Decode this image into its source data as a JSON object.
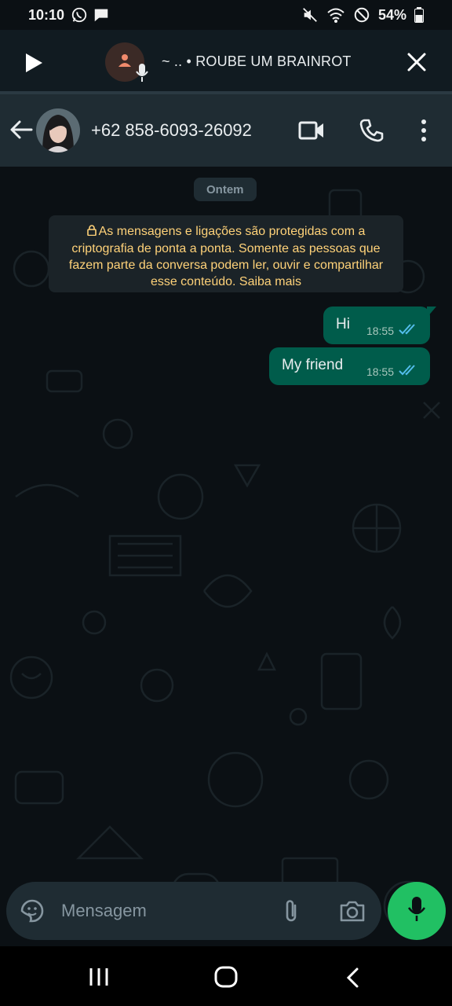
{
  "status_bar": {
    "time": "10:10",
    "battery": "54%"
  },
  "voice_banner": {
    "title": "~ .. • ROUBE UM BRAINROT"
  },
  "header": {
    "contact_name": "+62 858-6093-26092"
  },
  "chat": {
    "date_chip": "Ontem",
    "encryption_notice": "As mensagens e ligações são protegidas com a criptografia de ponta a ponta. Somente as pessoas que fazem parte da conversa podem ler, ouvir e compartilhar esse conteúdo. Saiba mais",
    "messages": [
      {
        "text": "Hi",
        "time": "18:55",
        "status": "read"
      },
      {
        "text": "My friend",
        "time": "18:55",
        "status": "read"
      }
    ]
  },
  "input": {
    "placeholder": "Mensagem"
  },
  "colors": {
    "bubble_outgoing": "#005c4b",
    "header_bg": "#1f2c33",
    "accent_green": "#21c063",
    "read_ticks": "#53bdeb",
    "notice_text": "#ffd279"
  },
  "icons": {
    "status_left": [
      "whatsapp-icon",
      "message-icon"
    ],
    "status_right": [
      "mute-icon",
      "wifi-icon",
      "dnd-icon",
      "battery-icon"
    ],
    "banner": [
      "play-icon",
      "person-icon",
      "mic-icon",
      "close-icon"
    ],
    "header": [
      "back-arrow-icon",
      "video-call-icon",
      "phone-icon",
      "more-vert-icon"
    ],
    "input": [
      "sticker-icon",
      "attach-icon",
      "camera-icon",
      "mic-icon"
    ],
    "nav": [
      "recents-icon",
      "home-icon",
      "back-icon"
    ]
  }
}
